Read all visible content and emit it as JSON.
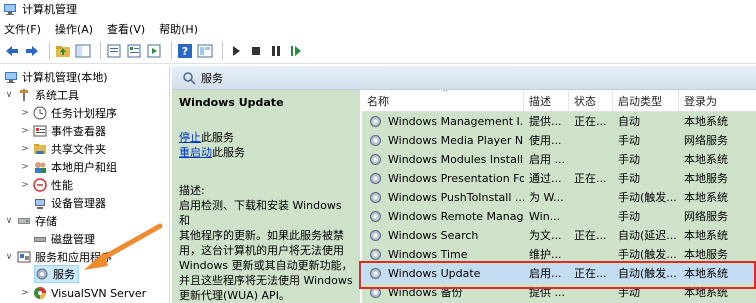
{
  "window": {
    "title": "计算机管理"
  },
  "menu": [
    "文件(F)",
    "操作(A)",
    "查看(V)",
    "帮助(H)"
  ],
  "toolbar": {
    "icons": [
      "back-arrow-icon",
      "forward-arrow-icon",
      "up-folder-icon",
      "show-hide-tree-icon",
      "export-icon",
      "properties-icon",
      "help-icon",
      "view-icon",
      "play-icon",
      "stop-icon",
      "pause-icon",
      "resume-icon"
    ]
  },
  "tree": {
    "root": "计算机管理(本地)",
    "items": [
      {
        "label": "系统工具",
        "level": 1,
        "exp": "∨"
      },
      {
        "label": "任务计划程序",
        "level": 2,
        "exp": ">"
      },
      {
        "label": "事件查看器",
        "level": 2,
        "exp": ">"
      },
      {
        "label": "共享文件夹",
        "level": 2,
        "exp": ">"
      },
      {
        "label": "本地用户和组",
        "level": 2,
        "exp": ">"
      },
      {
        "label": "性能",
        "level": 2,
        "exp": ">"
      },
      {
        "label": "设备管理器",
        "level": 2,
        "exp": ""
      },
      {
        "label": "存储",
        "level": 1,
        "exp": "∨"
      },
      {
        "label": "磁盘管理",
        "level": 2,
        "exp": ""
      },
      {
        "label": "服务和应用程序",
        "level": 1,
        "exp": "∨"
      },
      {
        "label": "服务",
        "level": 2,
        "exp": ""
      },
      {
        "label": "VisualSVN Server",
        "level": 2,
        "exp": ">"
      }
    ]
  },
  "header": {
    "title": "服务"
  },
  "desc": {
    "title": "Windows Update",
    "stop_link": "停止",
    "stop_suffix": "此服务",
    "restart_link": "重启动",
    "restart_suffix": "此服务",
    "label": "描述:",
    "lines": [
      "启用检测、下载和安装 Windows 和",
      "其他程序的更新。如果此服务被禁",
      "用，这台计算机的用户将无法使用",
      "Windows 更新或其自动更新功能，",
      "并且这些程序将无法使用 Windows",
      "更新代理(WUA) API。"
    ]
  },
  "table": {
    "columns": [
      "名称",
      "描述",
      "状态",
      "启动类型",
      "登录为"
    ],
    "rows": [
      [
        "Windows Management I...",
        "提供...",
        "正在...",
        "自动",
        "本地系统"
      ],
      [
        "Windows Media Player N...",
        "使用...",
        "",
        "手动",
        "网络服务"
      ],
      [
        "Windows Modules Install...",
        "启用 ...",
        "",
        "手动",
        "本地系统"
      ],
      [
        "Windows Presentation Fo...",
        "通过...",
        "正在...",
        "手动",
        "本地服务"
      ],
      [
        "Windows PushToInstall ...",
        "为 W...",
        "",
        "手动(触发...",
        "本地系统"
      ],
      [
        "Windows Remote Manag...",
        "Win...",
        "",
        "手动",
        "网络服务"
      ],
      [
        "Windows Search",
        "为文...",
        "正在...",
        "自动(延迟...",
        "本地系统"
      ],
      [
        "Windows Time",
        "维护...",
        "",
        "手动(触发...",
        "本地服务"
      ],
      [
        "Windows Update",
        "启用...",
        "正在...",
        "自动(触发...",
        "本地系统"
      ],
      [
        "Windows 备份",
        "提供 ...",
        "",
        "手动",
        "本地系统"
      ]
    ],
    "selected_index": 8
  },
  "colors": {
    "highlight_border": "#e32a2a",
    "annotation_arrow": "#f08a2c",
    "desc_bg": "#cfe3cb",
    "link": "#0033cc"
  }
}
